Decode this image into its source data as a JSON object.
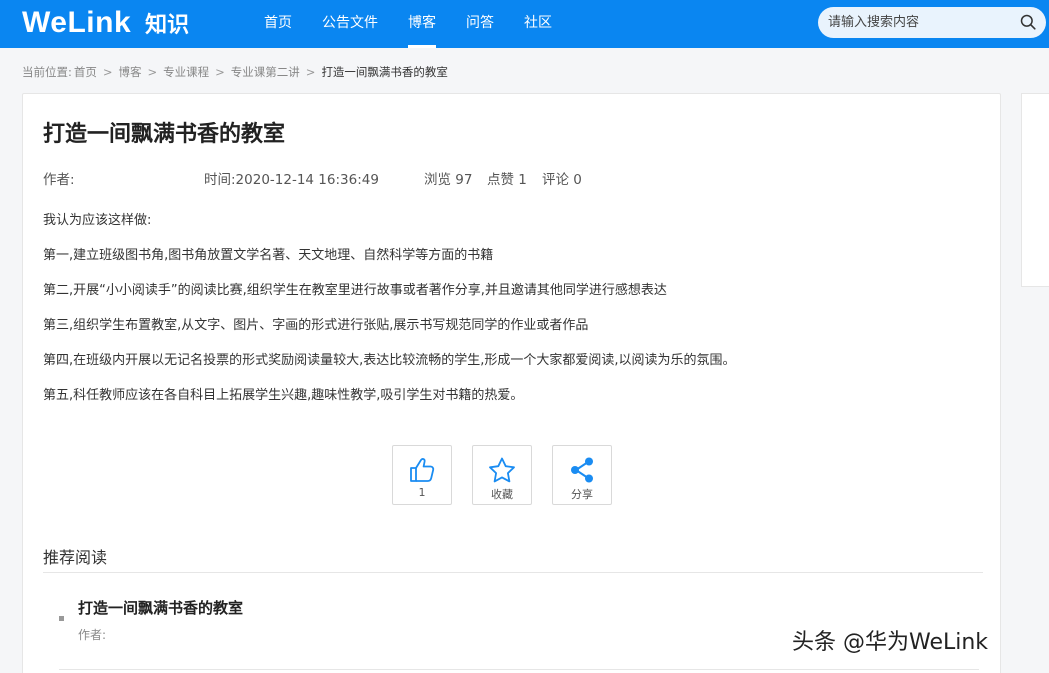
{
  "header": {
    "logo_brand": "WeLink",
    "logo_sub": "知识",
    "nav": [
      {
        "label": "首页",
        "active": false
      },
      {
        "label": "公告文件",
        "active": false
      },
      {
        "label": "博客",
        "active": true
      },
      {
        "label": "问答",
        "active": false
      },
      {
        "label": "社区",
        "active": false
      }
    ],
    "search_placeholder": "请输入搜索内容",
    "search_icon": "search-icon"
  },
  "breadcrumb": {
    "prefix": "当前位置:",
    "items": [
      "首页",
      "博客",
      "专业课程",
      "专业课第二讲"
    ],
    "current": "打造一间飘满书香的教室",
    "separator": ">"
  },
  "article": {
    "title": "打造一间飘满书香的教室",
    "author_label": "作者:",
    "time": "时间:2020-12-14 16:36:49",
    "views": "浏览 97",
    "likes": "点赞 1",
    "comments": "评论 0",
    "paragraphs": [
      "我认为应该这样做:",
      "第一,建立班级图书角,图书角放置文学名著、天文地理、自然科学等方面的书籍",
      "第二,开展“小小阅读手”的阅读比赛,组织学生在教室里进行故事或者著作分享,并且邀请其他同学进行感想表达",
      "第三,组织学生布置教室,从文字、图片、字画的形式进行张贴,展示书写规范同学的作业或者作品",
      "第四,在班级内开展以无记名投票的形式奖励阅读量较大,表达比较流畅的学生,形成一个大家都爱阅读,以阅读为乐的氛围。",
      "第五,科任教师应该在各自科目上拓展学生兴趣,趣味性教学,吸引学生对书籍的热爱。"
    ]
  },
  "actions": {
    "like_count": "1",
    "favorite_label": "收藏",
    "share_label": "分享"
  },
  "recommend": {
    "heading": "推荐阅读",
    "items": [
      {
        "title": "打造一间飘满书香的教室",
        "author_label": "作者:"
      }
    ]
  },
  "watermark": "头条 @华为WeLink",
  "colors": {
    "brand": "#0a86f1",
    "icon_blue": "#1a8cf2"
  }
}
